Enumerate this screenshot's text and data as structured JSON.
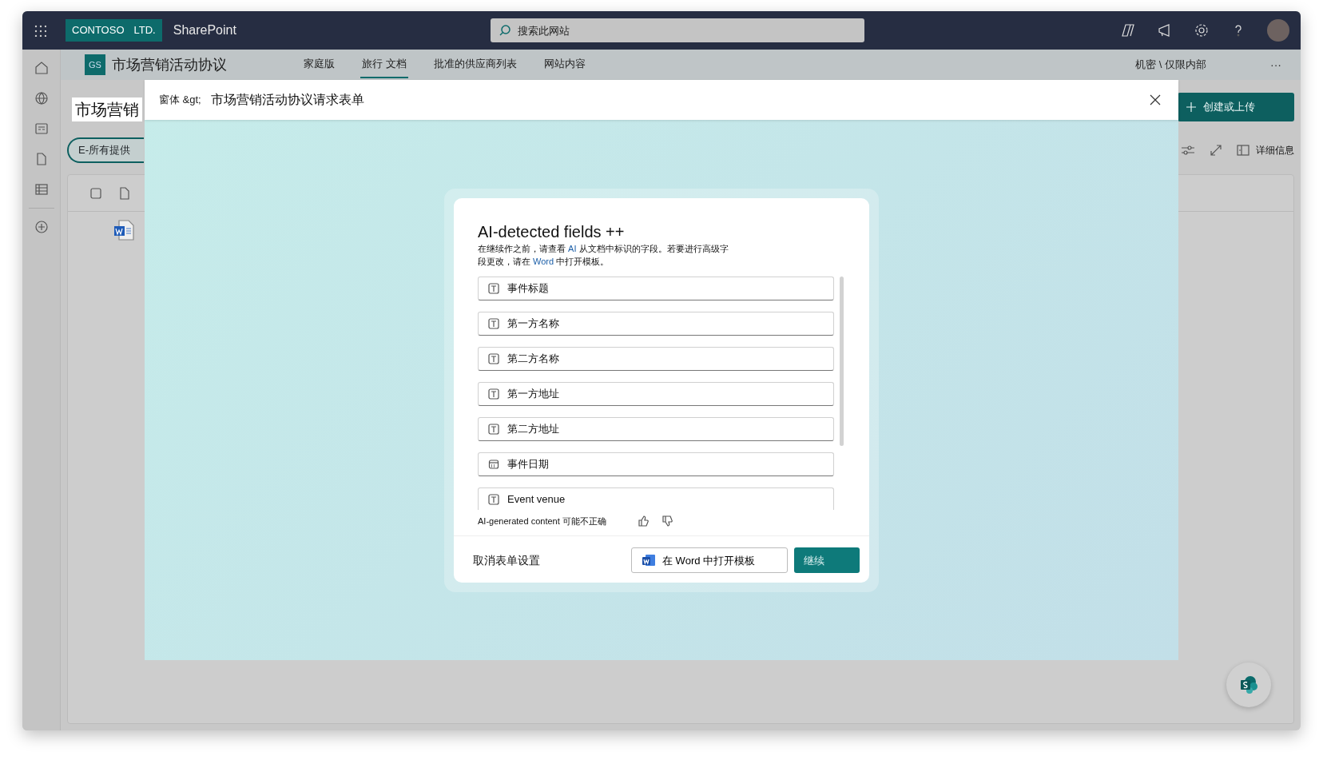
{
  "app_bar": {
    "brand": "CONTOSO",
    "brand_suffix": "LTD.",
    "app_name": "SharePoint",
    "search": {
      "placeholder": "搜索此网站"
    }
  },
  "site_header": {
    "logo": "GS",
    "title": "市场营销活动协议",
    "more": "···",
    "sensitivity": "机密 \\ 仅限内部",
    "nav": [
      {
        "label": "家庭版",
        "selected": false
      },
      {
        "label": "旅行 文档",
        "selected": true
      },
      {
        "label": "批准的供应商列表",
        "selected": false
      },
      {
        "label": "网站内容",
        "selected": false
      }
    ]
  },
  "page": {
    "title": "市场营销",
    "view_pill": "E-所有提供",
    "create_button": "创建或上传",
    "details": "详细信息"
  },
  "dialog": {
    "breadcrumb": "窗体 &gt;",
    "title": "市场营销活动协议请求表单",
    "card": {
      "heading": "AI-detected fields ++",
      "description": [
        {
          "kind": "plain",
          "text": "在继续作之前，请查看 "
        },
        {
          "kind": "link",
          "text": "AI"
        },
        {
          "kind": "plain",
          "text": " 从文档中标识的字段。若要进行高级字段更改，请在 "
        },
        {
          "kind": "link",
          "text": "Word"
        },
        {
          "kind": "plain",
          "text": " 中打开模板。"
        }
      ],
      "fields": [
        {
          "kind": "text",
          "label": "事件标题"
        },
        {
          "kind": "text",
          "label": "第一方名称"
        },
        {
          "kind": "text",
          "label": "第二方名称"
        },
        {
          "kind": "text",
          "label": "第一方地址"
        },
        {
          "kind": "text",
          "label": "第二方地址"
        },
        {
          "kind": "date",
          "label": "事件日期"
        },
        {
          "kind": "text",
          "label": "Event venue"
        }
      ],
      "disclaimer": "AI-generated content 可能不正确",
      "cancel": "取消表单设置",
      "open_word": "在 Word 中打开模板",
      "continue": "继续"
    }
  }
}
